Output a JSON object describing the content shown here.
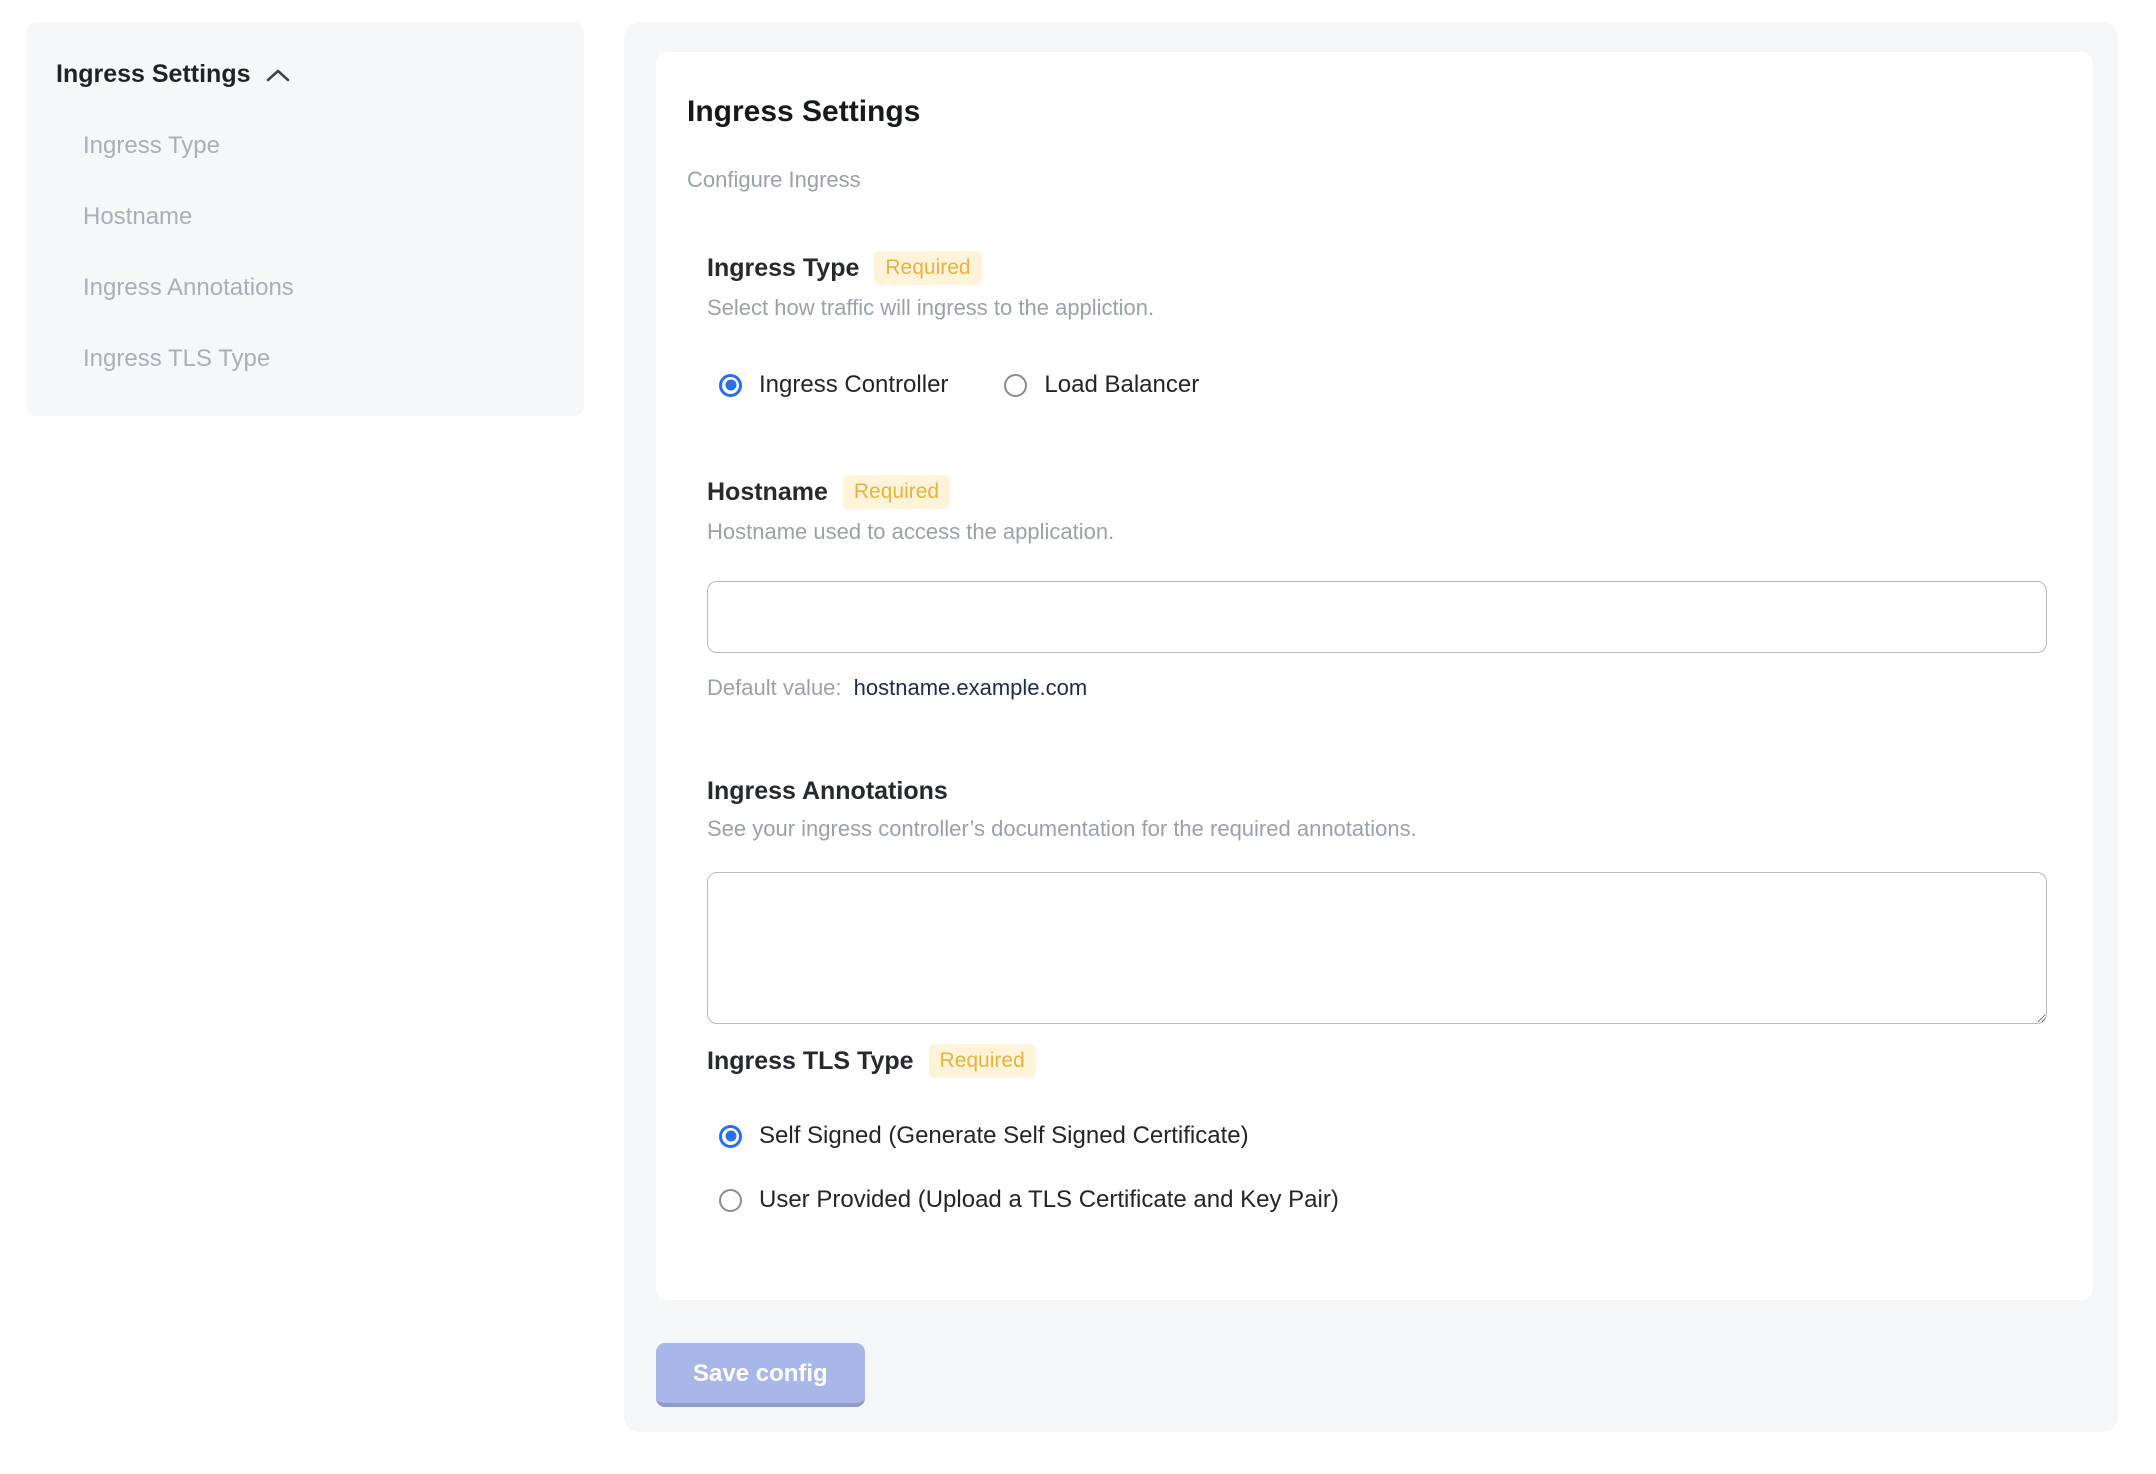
{
  "sidebar": {
    "header": "Ingress Settings",
    "items": [
      {
        "label": "Ingress Type"
      },
      {
        "label": "Hostname"
      },
      {
        "label": "Ingress Annotations"
      },
      {
        "label": "Ingress TLS Type"
      }
    ]
  },
  "main": {
    "title": "Ingress Settings",
    "subtitle": "Configure Ingress",
    "sections": {
      "ingress_type": {
        "title": "Ingress Type",
        "required_label": "Required",
        "description": "Select how traffic will ingress to the appliction.",
        "options": [
          {
            "label": "Ingress Controller",
            "selected": true
          },
          {
            "label": "Load Balancer",
            "selected": false
          }
        ]
      },
      "hostname": {
        "title": "Hostname",
        "required_label": "Required",
        "description": "Hostname used to access the application.",
        "input_value": "",
        "default_prefix": "Default value:",
        "default_value": "hostname.example.com"
      },
      "ingress_annotations": {
        "title": "Ingress Annotations",
        "description": "See your ingress controller’s documentation for the required annotations.",
        "textarea_value": ""
      },
      "ingress_tls_type": {
        "title": "Ingress TLS Type",
        "required_label": "Required",
        "options": [
          {
            "label": "Self Signed (Generate Self Signed Certificate)",
            "selected": true
          },
          {
            "label": "User Provided (Upload a TLS Certificate and Key Pair)",
            "selected": false
          }
        ]
      }
    },
    "save_button_label": "Save config"
  },
  "colors": {
    "accent_blue": "#2970e8",
    "badge_bg": "#fcf3d8",
    "badge_text": "#e8b240",
    "panel_bg": "#f4f6f8",
    "sidebar_bg": "#f6f7f9",
    "save_button_bg": "#a9b7e8",
    "default_value_text": "#1e2b4d"
  }
}
